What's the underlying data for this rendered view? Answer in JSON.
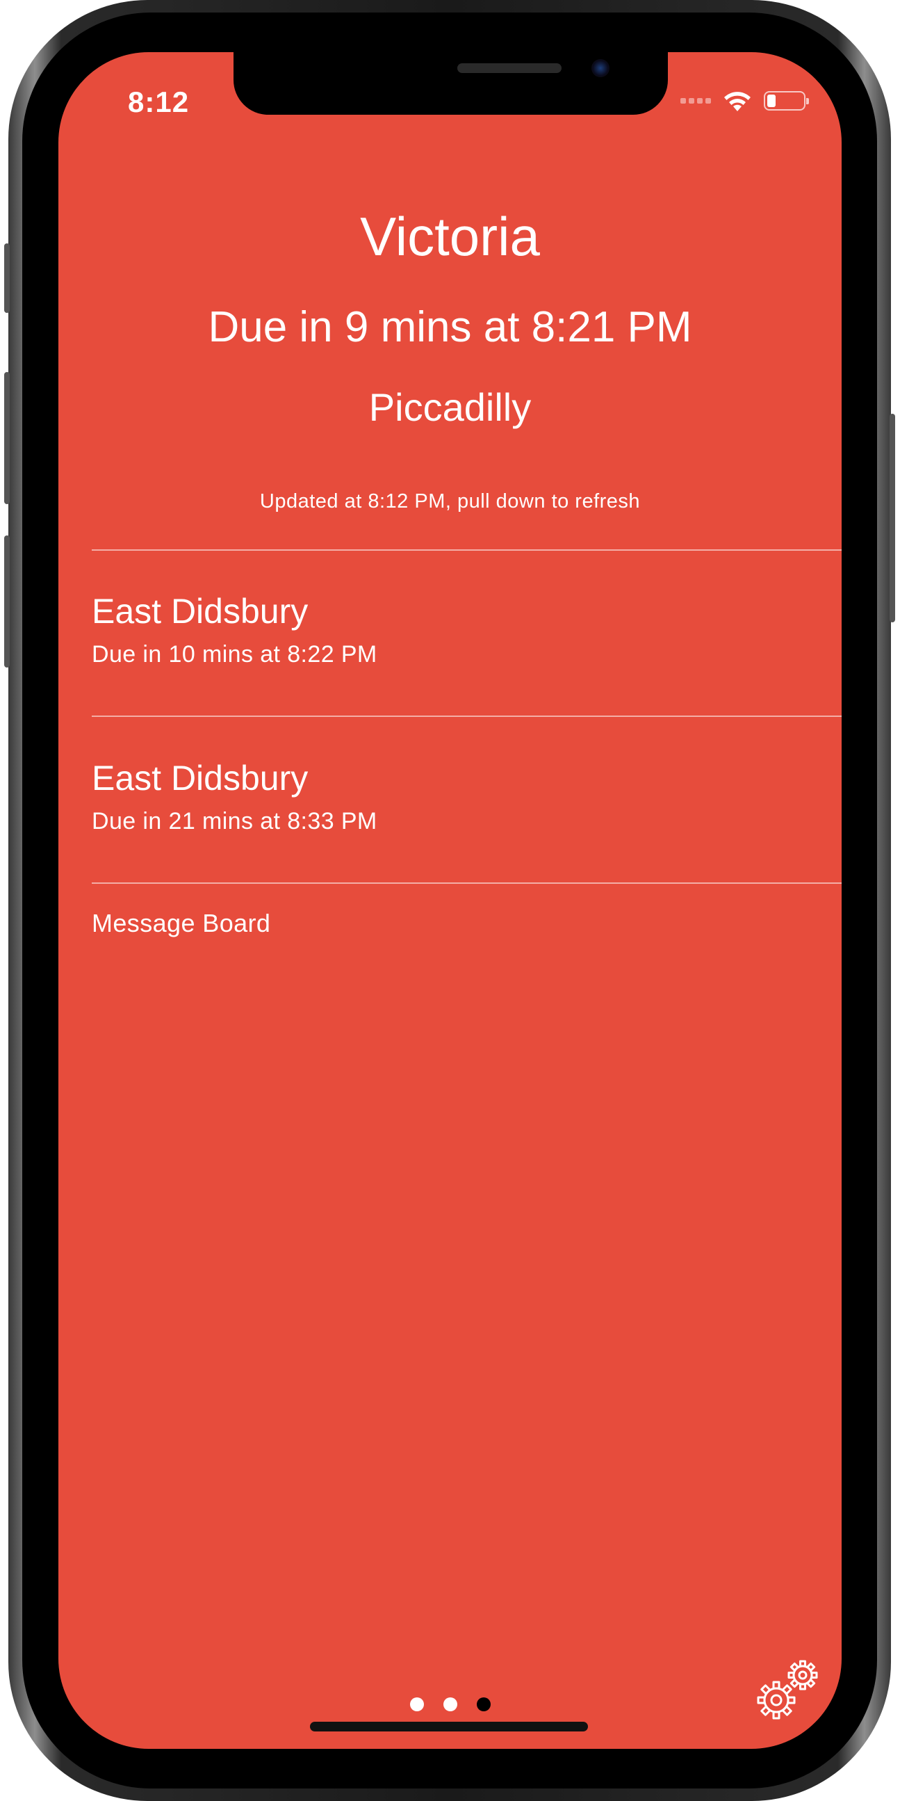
{
  "status_bar": {
    "time": "8:12",
    "icons": [
      "signal-icon",
      "wifi-icon",
      "battery-icon"
    ]
  },
  "header": {
    "station": "Victoria",
    "next_due": "Due in 9 mins at 8:21 PM",
    "destination": "Piccadilly",
    "updated": "Updated at 8:12 PM, pull down to refresh"
  },
  "trams": [
    {
      "destination": "East Didsbury",
      "due": "Due in 10 mins at 8:22 PM"
    },
    {
      "destination": "East Didsbury",
      "due": "Due in 21 mins at 8:33 PM"
    }
  ],
  "message_board": {
    "label": "Message Board"
  },
  "pager": {
    "count": 3,
    "active_index": 2
  },
  "colors": {
    "background": "#E74C3C",
    "text": "#FFFFFF",
    "active_dot": "#000000"
  },
  "settings": {
    "icon": "gears-icon"
  }
}
